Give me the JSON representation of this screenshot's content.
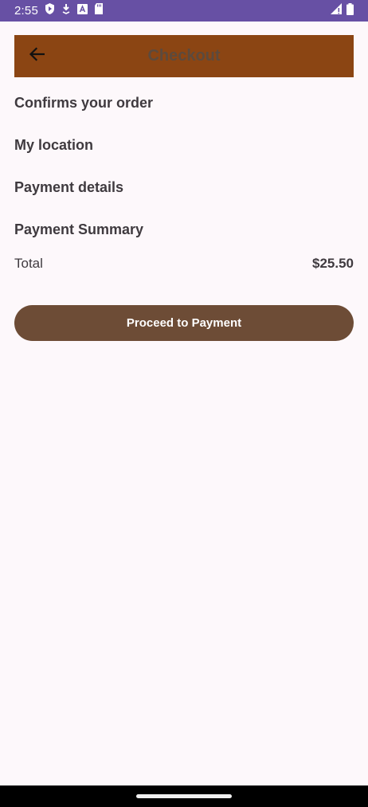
{
  "status_bar": {
    "time": "2:55",
    "icons": [
      "shield-icon",
      "download-icon",
      "font-icon",
      "sdcard-icon",
      "signal-icon",
      "battery-icon"
    ]
  },
  "app_bar": {
    "title": "Checkout",
    "back_icon": "arrow-back-icon",
    "background": "#8b4513"
  },
  "sections": {
    "confirm_order": "Confirms your order",
    "location": "My location",
    "payment_details": "Payment details",
    "payment_summary": "Payment Summary"
  },
  "summary": {
    "total_label": "Total",
    "total_value": "$25.50"
  },
  "actions": {
    "proceed_label": "Proceed to Payment",
    "proceed_color": "#6d4c36"
  },
  "colors": {
    "status_bar": "#6750a4",
    "background": "#fdf8fb"
  }
}
